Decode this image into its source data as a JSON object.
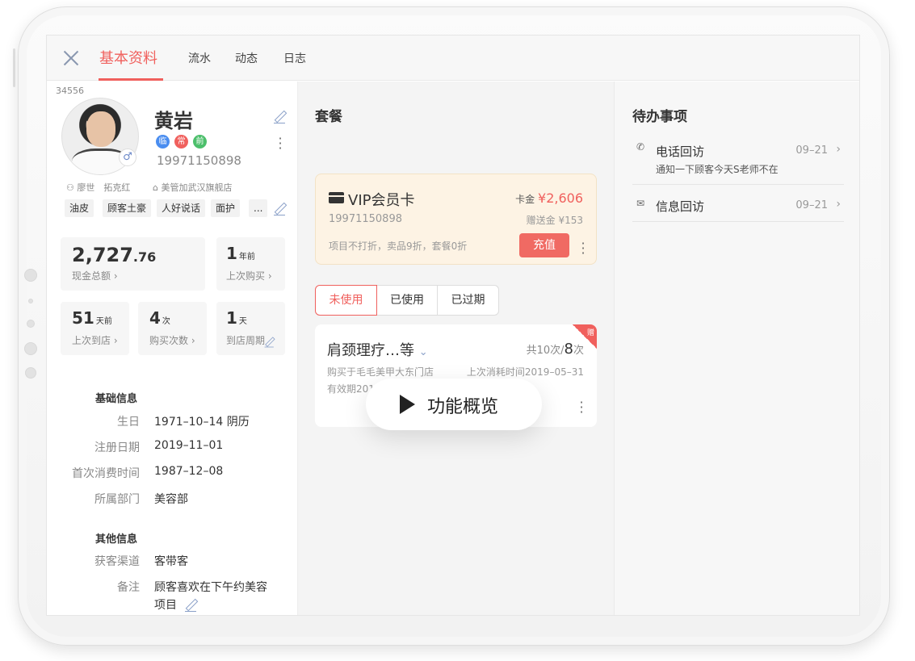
{
  "header": {
    "tabs": [
      {
        "label": "基本资料",
        "active": true
      },
      {
        "label": "流水"
      },
      {
        "label": "动态"
      },
      {
        "label": "日志"
      }
    ]
  },
  "customer": {
    "id": "34556",
    "name": "黄岩",
    "badges": [
      {
        "label": "临",
        "color": "#4a8df0"
      },
      {
        "label": "常",
        "color": "#f0605d"
      },
      {
        "label": "前",
        "color": "#4cbf6b"
      }
    ],
    "gender_symbol": "♂",
    "phone": "19971150898",
    "advisors": "廖世　拓克红",
    "store": "美管加武汉旗舰店",
    "tags": [
      "油皮",
      "顾客土豪",
      "人好说话",
      "面护",
      "..."
    ]
  },
  "stats": {
    "cash_total_int": "2,727",
    "cash_total_dec": ".76",
    "cash_total_label": "现金总额",
    "last_purchase_num": "1",
    "last_purchase_unit": "年前",
    "last_purchase_label": "上次购买",
    "last_visit_num": "51",
    "last_visit_unit": "天前",
    "last_visit_label": "上次到店",
    "purchase_count_num": "4",
    "purchase_count_unit": "次",
    "purchase_count_label": "购买次数",
    "visit_cycle_num": "1",
    "visit_cycle_unit": "天",
    "visit_cycle_label": "到店周期"
  },
  "basic_info": {
    "title": "基础信息",
    "rows": [
      {
        "key": "生日",
        "value": "1971–10–14 阴历"
      },
      {
        "key": "注册日期",
        "value": "2019–11–01"
      },
      {
        "key": "首次消费时间",
        "value": "1987–12–08"
      },
      {
        "key": "所属部门",
        "value": "美容部"
      }
    ]
  },
  "other_info": {
    "title": "其他信息",
    "rows": [
      {
        "key": "获客渠道",
        "value": "客带客"
      },
      {
        "key": "备注",
        "value": "顾客喜欢在下午约美容",
        "value2": "项目"
      }
    ]
  },
  "package": {
    "title": "套餐",
    "vip_card": {
      "name": "VIP会员卡",
      "phone": "19971150898",
      "balance_label": "卡金",
      "balance": "¥2,606",
      "gift_label": "赠送金",
      "gift": "¥153",
      "discount": "项目不打折，卖品9折，套餐0折",
      "recharge_label": "充值"
    },
    "filters": [
      {
        "label": "未使用",
        "active": true
      },
      {
        "label": "已使用"
      },
      {
        "label": "已过期"
      }
    ],
    "item": {
      "name": "肩颈理疗…等",
      "total_prefix": "共10次/",
      "remain_num": "8",
      "remain_unit": "次",
      "corner": "赠",
      "store": "购买于毛毛美甲大东门店",
      "last_used": "上次消耗时间2019–05–31",
      "validity": "有效期2019–5–21至2021–5–21"
    }
  },
  "overlay": {
    "label": "功能概览"
  },
  "todo": {
    "title": "待办事项",
    "items": [
      {
        "title": "电话回访",
        "date": "09–21",
        "desc": "通知一下顾客今天S老师不在"
      },
      {
        "title": "信息回访",
        "date": "09–21"
      }
    ]
  }
}
